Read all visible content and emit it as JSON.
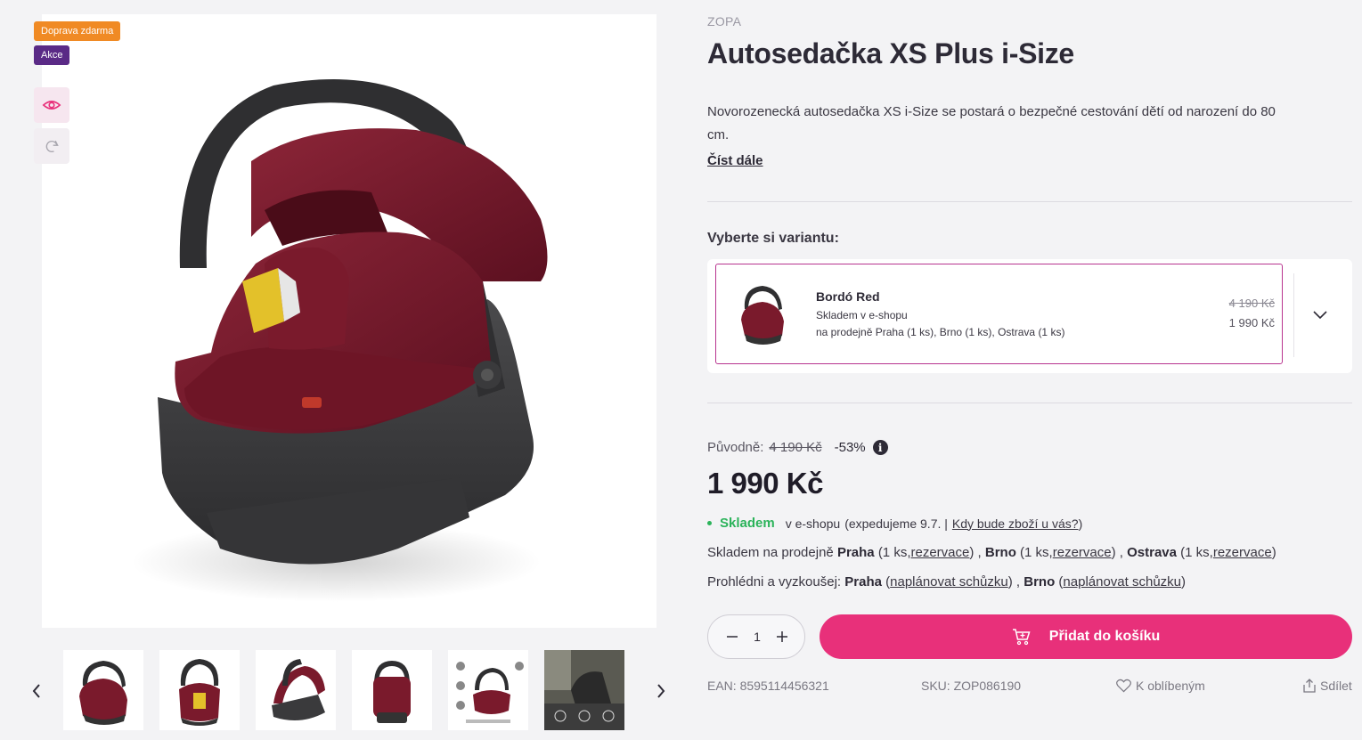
{
  "badges": {
    "free_shipping": "Doprava zdarma",
    "sale": "Akce"
  },
  "tools": {
    "view": "eye-icon",
    "rotate": "rotate-360-icon"
  },
  "product": {
    "brand": "ZOPA",
    "title": "Autosedačka XS Plus i-Size",
    "description": "Novorozenecká autosedačka XS i-Size se postará o bezpečné cestování dětí od narození do 80 cm.",
    "read_more": "Číst dále"
  },
  "variant": {
    "heading": "Vyberte si variantu:",
    "name": "Bordó Red",
    "stock": "Skladem v e-shopu",
    "stores": "na prodejně Praha (1 ks), Brno (1 ks), Ostrava (1 ks)",
    "old_price": "4 190 Kč",
    "new_price": "1 990 Kč"
  },
  "pricing": {
    "original_label": "Původně:",
    "original_price": "4 190 Kč",
    "discount": "-53%",
    "info_icon": "i",
    "price": "1 990 Kč"
  },
  "availability": {
    "status": "Skladem",
    "eshop": "v e-shopu",
    "dispatch_prefix": "(expedujeme 9.7. |",
    "when_link": "Kdy bude zboží u vás?",
    "close_paren": ")",
    "stores_prefix": "Skladem na prodejně",
    "stores": [
      {
        "city": "Praha",
        "qty": "(1 ks,",
        "link": "rezervace",
        "suffix": ") ,"
      },
      {
        "city": "Brno",
        "qty": "(1 ks,",
        "link": "rezervace",
        "suffix": ") ,"
      },
      {
        "city": "Ostrava",
        "qty": "(1 ks,",
        "link": "rezervace",
        "suffix": ")"
      }
    ],
    "showroom_prefix": "Prohlédni a vyzkoušej:",
    "showrooms": [
      {
        "city": "Praha",
        "link": "naplánovat schůzku",
        "suffix": " ,"
      },
      {
        "city": "Brno",
        "link": "naplánovat schůzku",
        "suffix": ""
      }
    ]
  },
  "cart": {
    "quantity": "1",
    "add_label": "Přidat do košíku"
  },
  "meta": {
    "ean": "EAN: 8595114456321",
    "sku": "SKU: ZOP086190",
    "favorite": "K oblíbeným",
    "share": "Sdílet"
  },
  "colors": {
    "accent": "#e8307a",
    "variant_border": "#b8348f",
    "in_stock": "#2bb35a",
    "badge_orange": "#f08a24",
    "badge_purple": "#5a2a86"
  }
}
